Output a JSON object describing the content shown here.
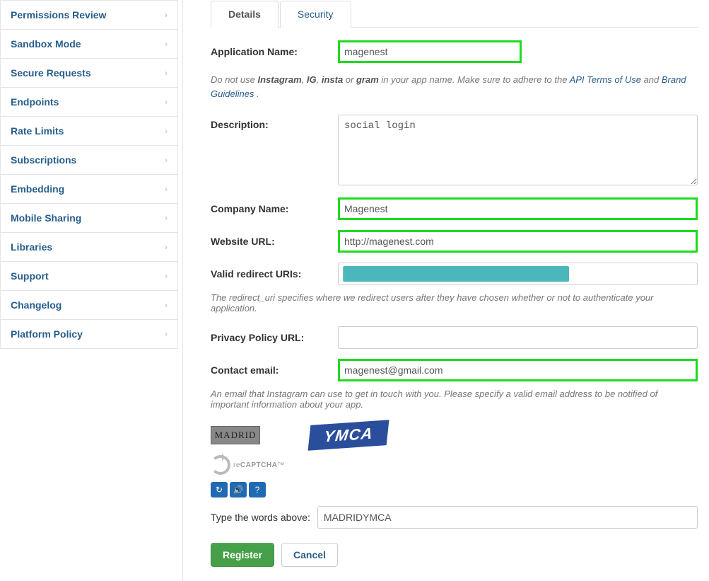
{
  "sidebar": {
    "items": [
      {
        "label": "Permissions Review"
      },
      {
        "label": "Sandbox Mode"
      },
      {
        "label": "Secure Requests"
      },
      {
        "label": "Endpoints"
      },
      {
        "label": "Rate Limits"
      },
      {
        "label": "Subscriptions"
      },
      {
        "label": "Embedding"
      },
      {
        "label": "Mobile Sharing"
      },
      {
        "label": "Libraries"
      },
      {
        "label": "Support"
      },
      {
        "label": "Changelog"
      },
      {
        "label": "Platform Policy"
      }
    ]
  },
  "tabs": {
    "details": "Details",
    "security": "Security"
  },
  "form": {
    "app_name_label": "Application Name:",
    "app_name_value": "magenest",
    "description_label": "Description:",
    "description_value": "social login",
    "company_label": "Company Name:",
    "company_value": "Magenest",
    "website_label": "Website URL:",
    "website_value": "http://magenest.com",
    "redirect_label": "Valid redirect URIs:",
    "privacy_label": "Privacy Policy URL:",
    "privacy_value": "",
    "contact_label": "Contact email:",
    "contact_value": "magenest@gmail.com"
  },
  "hints": {
    "name_pre": "Do not use ",
    "name_b1": "Instagram",
    "name_s1": ", ",
    "name_b2": "IG",
    "name_s2": ", ",
    "name_b3": "insta",
    "name_s3": " or ",
    "name_b4": "gram",
    "name_post": " in your app name. Make sure to adhere to the ",
    "api_link": "API Terms of Use",
    "name_and": " and ",
    "brand_link": "Brand Guidelines",
    "name_dot": " .",
    "redirect": "The redirect_uri specifies where we redirect users after they have chosen whether or not to authenticate your application.",
    "contact": "An email that Instagram can use to get in touch with you. Please specify a valid email address to be notified of important information about your app."
  },
  "captcha": {
    "img1": "MADRID",
    "img2": "YMCA",
    "recaptcha_pre": "re",
    "recaptcha_mid": "CAPTCHA",
    "recaptcha_tm": "™",
    "type_label": "Type the words above:",
    "typed_value": "MADRIDYMCA"
  },
  "buttons": {
    "register": "Register",
    "cancel": "Cancel"
  }
}
